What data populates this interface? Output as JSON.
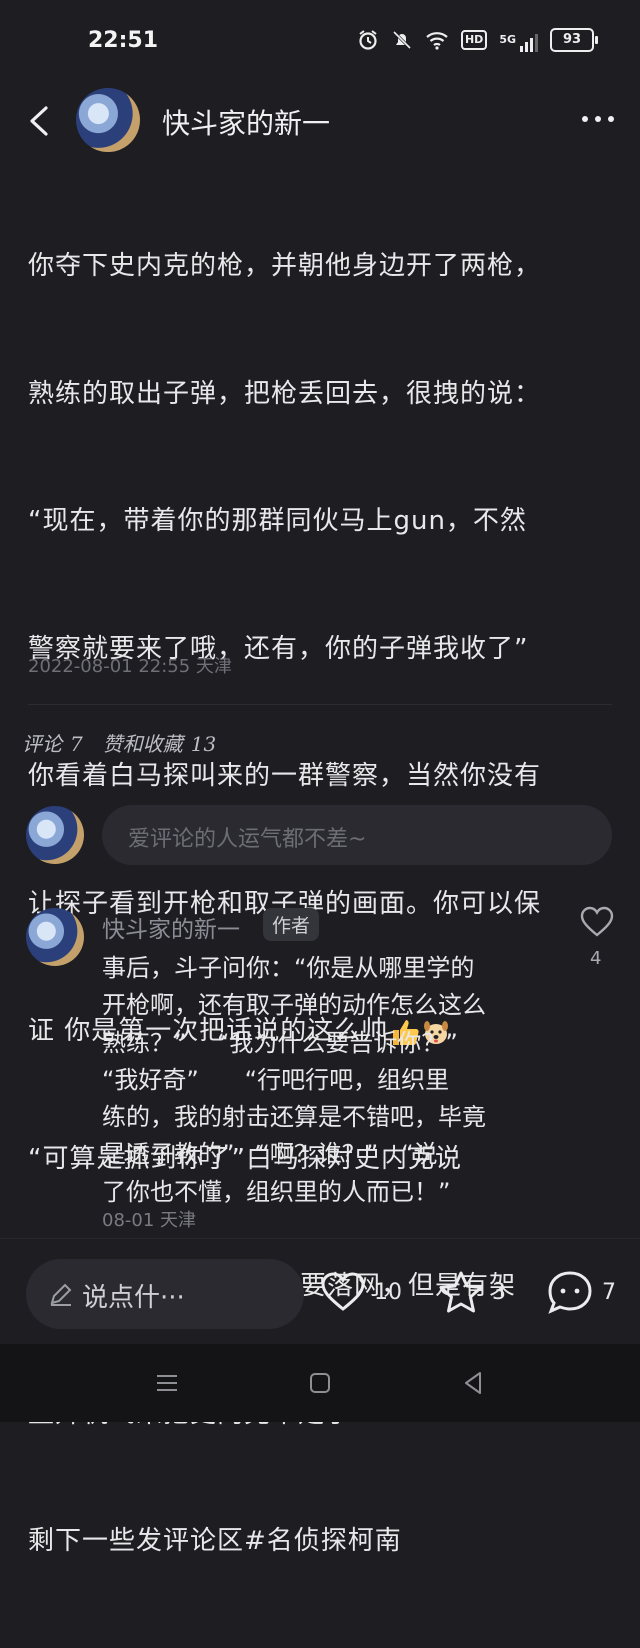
{
  "status_bar": {
    "time": "22:51",
    "battery": "93",
    "hd": "HD",
    "network": "5G"
  },
  "header": {
    "title": "快斗家的新一"
  },
  "post": {
    "lines": [
      "你夺下史内克的枪，并朝他身边开了两枪，",
      "熟练的取出子弹，把枪丢回去，很拽的说：",
      "“现在，带着你的那群同伙马上gun，不然",
      "警察就要来了哦，还有，你的子弹我收了”",
      "你看着白马探叫来的一群警察，当然你没有",
      "让探子看到开枪和取子弹的画面。你可以保",
      "证 你是第一次把话说的这么帅",
      "“可算是抓到你了”白马探对史内克说",
      "“你们！”眼看史内克就要落网，但是有架",
      "直升机飞来把史内克带走了……",
      "剩下一些发评论区"
    ],
    "hashtag": "#名侦探柯南",
    "meta": "2022-08-01 22:55 天津"
  },
  "tabs": {
    "comments_label": "评论",
    "comments_count": "7",
    "likes_label": "赞和收藏",
    "likes_count": "13"
  },
  "comment_input": {
    "placeholder": "爱评论的人运气都不差~"
  },
  "comment": {
    "author": "快斗家的新一",
    "badge": "作者",
    "like_count": "4",
    "lines": [
      "事后，斗子问你：“你是从哪里学的",
      "开枪啊，还有取子弹的动作怎么这么",
      "熟练？”    “我为什么要告诉你？”",
      "“我好奇”      “行吧行吧，组织里",
      "练的，我的射击还算是不错吧，毕竟",
      "是透子教的”   “啊？谁？”   “说",
      "了你也不懂，组织里的人而已！”"
    ],
    "meta": "08-01 天津"
  },
  "action_bar": {
    "say_label": "说点什···",
    "likes": "10",
    "stars": "3",
    "comments": "7"
  },
  "colors": {
    "background": "#1d1d22",
    "text": "#e8e8ea",
    "muted": "#6f6f77"
  }
}
